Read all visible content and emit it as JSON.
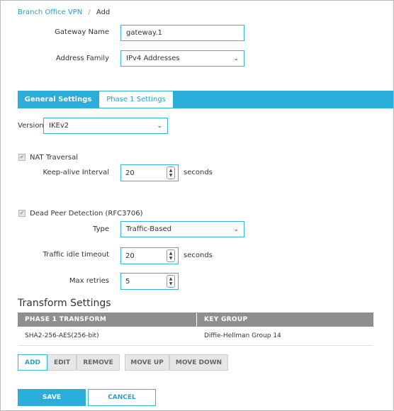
{
  "breadcrumb": {
    "parent": "Branch Office VPN",
    "separator": "/",
    "current": "Add"
  },
  "gateway": {
    "name_label": "Gateway Name",
    "name_value": "gateway.1"
  },
  "address_family": {
    "label": "Address Family",
    "value": "IPv4 Addresses"
  },
  "tabs": [
    {
      "label": "General Settings"
    },
    {
      "label": "Phase 1 Settings"
    }
  ],
  "version": {
    "label": "Version",
    "value": "IKEv2"
  },
  "nat": {
    "label": "NAT Traversal",
    "checked": true,
    "keepalive_label": "Keep-alive Interval",
    "keepalive_value": "20",
    "unit": "seconds"
  },
  "dpd": {
    "label": "Dead Peer Detection (RFC3706)",
    "checked": true,
    "type_label": "Type",
    "type_value": "Traffic-Based",
    "idle_label": "Traffic idle timeout",
    "idle_value": "20",
    "idle_unit": "seconds",
    "retries_label": "Max retries",
    "retries_value": "5"
  },
  "transform": {
    "title": "Transform Settings",
    "columns": [
      "PHASE 1 TRANSFORM",
      "KEY GROUP"
    ],
    "rows": [
      [
        "SHA2-256-AES(256-bit)",
        "Diffie-Hellman Group 14"
      ]
    ]
  },
  "actions": {
    "add": "ADD",
    "edit": "EDIT",
    "remove": "REMOVE",
    "move_up": "MOVE UP",
    "move_down": "MOVE DOWN"
  },
  "footer": {
    "save": "SAVE",
    "cancel": "CANCEL"
  },
  "icons": {
    "check": "✔",
    "chevron": "⌄",
    "up": "▲",
    "down": "▼"
  },
  "colors": {
    "accent": "#2aaed9",
    "header_gray": "#8f8f8f"
  }
}
